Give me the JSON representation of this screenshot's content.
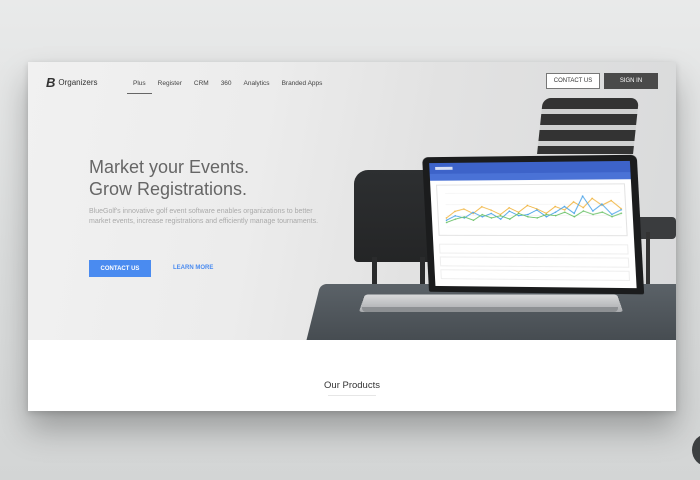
{
  "brand": {
    "mark": "B",
    "name": "Organizers"
  },
  "nav": {
    "items": [
      {
        "label": "Plus",
        "active": true
      },
      {
        "label": "Register",
        "active": false
      },
      {
        "label": "CRM",
        "active": false
      },
      {
        "label": "360",
        "active": false
      },
      {
        "label": "Analytics",
        "active": false
      },
      {
        "label": "Branded Apps",
        "active": false
      }
    ],
    "contact_label": "CONTACT US",
    "signin_label": "SIGN IN"
  },
  "hero": {
    "headline_line1": "Market your Events.",
    "headline_line2": "Grow Registrations.",
    "subtext": "BlueGolf's innovative golf event software enables organizations to better market events, increase registrations and efficiently manage tournaments.",
    "primary_label": "CONTACT US",
    "secondary_label": "LEARN MORE"
  },
  "products": {
    "title": "Our Products"
  },
  "chart_data": {
    "type": "line",
    "x": [
      1,
      2,
      3,
      4,
      5,
      6,
      7,
      8,
      9,
      10,
      11,
      12,
      13,
      14,
      15,
      16,
      17,
      18,
      19,
      20
    ],
    "series": [
      {
        "color": "#f0b33c",
        "values": [
          8,
          14,
          16,
          12,
          18,
          15,
          11,
          17,
          13,
          19,
          16,
          12,
          18,
          15,
          22,
          17,
          25,
          19,
          23,
          16
        ]
      },
      {
        "color": "#4aa3e8",
        "values": [
          6,
          10,
          8,
          13,
          9,
          12,
          7,
          14,
          10,
          11,
          15,
          9,
          13,
          18,
          12,
          27,
          14,
          20,
          11,
          15
        ]
      },
      {
        "color": "#6cc26a",
        "values": [
          4,
          7,
          9,
          6,
          11,
          8,
          10,
          7,
          12,
          9,
          8,
          11,
          10,
          13,
          9,
          14,
          11,
          13,
          9,
          12
        ]
      }
    ],
    "ylim": [
      0,
      30
    ]
  },
  "colors": {
    "accent": "#4a8bf0",
    "signin_bg": "#4a4a4a",
    "laptop_bar": "#3d63c9"
  }
}
